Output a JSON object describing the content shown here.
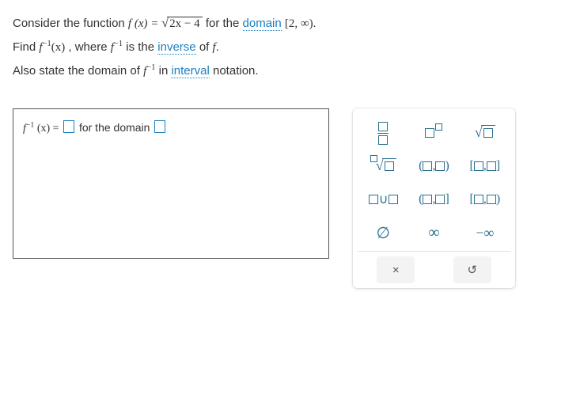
{
  "problem": {
    "line1_a": "Consider the function ",
    "func_lhs": "f (x) = ",
    "sqrt_body": "2x − 4",
    "line1_b": " for the ",
    "link_domain": "domain",
    "domain_interval": " [2, ∞).",
    "line2_a": "Find ",
    "finv": "f",
    "finv_exp": "−1",
    "finv_arg": "(x)",
    "line2_b": ", where ",
    "line2_c": " is the ",
    "link_inverse": "inverse",
    "line2_d": " of ",
    "line2_e": "f",
    "line2_f": ".",
    "line3_a": "Also state the domain of ",
    "line3_b": " in ",
    "link_interval": "interval",
    "line3_c": " notation."
  },
  "answer": {
    "lhs_f": "f",
    "lhs_exp": "−1",
    "lhs_arg": " (x)  =  ",
    "mid": " for the domain "
  },
  "palette": {
    "open_paren": "(",
    "close_paren": ")",
    "open_brack": "[",
    "close_brack": "]",
    "comma": ",",
    "union_u": "∪",
    "empty": "∅",
    "inf": "∞",
    "ninf": "−∞",
    "clear": "×",
    "reset": "↺"
  }
}
